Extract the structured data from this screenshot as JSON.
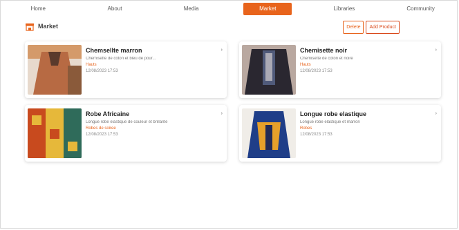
{
  "tabs": [
    {
      "label": "Home",
      "active": false
    },
    {
      "label": "About",
      "active": false
    },
    {
      "label": "Media",
      "active": false
    },
    {
      "label": "Market",
      "active": true
    },
    {
      "label": "Libraries",
      "active": false
    },
    {
      "label": "Community",
      "active": false
    }
  ],
  "header": {
    "title": "Market",
    "icon": "store-icon",
    "delete_label": "Delete",
    "add_label": "Add Product"
  },
  "products": [
    {
      "title": "Chemsellte marron",
      "desc": "Chemisette de coton et bleu de pour...",
      "category": "Hauts",
      "date": "12/08/2023 17:53",
      "thumb_colors": [
        "#5a3a2c",
        "#b76a43",
        "#d49a6a",
        "#e7d9cc"
      ]
    },
    {
      "title": "Chemisette noir",
      "desc": "Chemisette de coton et noire",
      "category": "Hauts",
      "date": "12/08/2023 17:53",
      "thumb_colors": [
        "#2a2730",
        "#505a7a",
        "#e8e0dc",
        "#b9a8a0"
      ]
    },
    {
      "title": "Robe Africaine",
      "desc": "Longue robe elastique de couleur et brillante",
      "category": "Robes de soiree",
      "date": "12/08/2023 17:53",
      "thumb_colors": [
        "#c84a1e",
        "#e6b83a",
        "#2f6b5a",
        "#6a3b2a"
      ]
    },
    {
      "title": "Longue robe elastique",
      "desc": "Longue robe elastique et marron",
      "category": "Robes",
      "date": "12/08/2023 17:53",
      "thumb_colors": [
        "#1f3e88",
        "#e6a02a",
        "#222a55",
        "#f0ede8"
      ]
    }
  ],
  "colors": {
    "accent": "#e8641c"
  }
}
